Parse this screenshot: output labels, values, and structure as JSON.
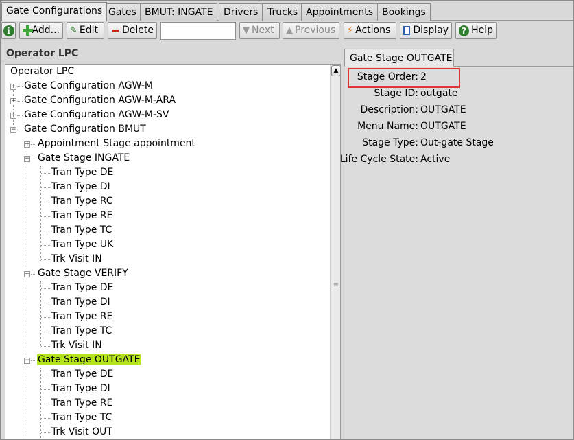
{
  "tabs": [
    {
      "label": "Gate Configurations",
      "active": true
    },
    {
      "label": "Gates"
    },
    {
      "label": "BMUT: INGATE"
    },
    {
      "label": "Drivers"
    },
    {
      "label": "Trucks"
    },
    {
      "label": "Appointments"
    },
    {
      "label": "Bookings"
    }
  ],
  "toolbar": {
    "add": "Add...",
    "edit": "Edit",
    "delete": "Delete",
    "search_value": "",
    "next": "Next",
    "previous": "Previous",
    "actions": "Actions",
    "display": "Display",
    "help": "Help"
  },
  "left_panel": {
    "title": "Operator LPC",
    "tree": [
      {
        "label": "Operator LPC"
      },
      {
        "label": "Gate Configuration AGW-M",
        "expander": "+"
      },
      {
        "label": "Gate Configuration AGW-M-ARA",
        "expander": "+"
      },
      {
        "label": "Gate Configuration AGW-M-SV",
        "expander": "+"
      },
      {
        "label": "Gate Configuration BMUT",
        "expander": "−"
      },
      {
        "label": "Appointment Stage appointment",
        "expander": "+"
      },
      {
        "label": "Gate Stage INGATE",
        "expander": "−"
      },
      {
        "label": "Tran Type DE"
      },
      {
        "label": "Tran Type DI"
      },
      {
        "label": "Tran Type RC"
      },
      {
        "label": "Tran Type RE"
      },
      {
        "label": "Tran Type TC"
      },
      {
        "label": "Tran Type UK"
      },
      {
        "label": "Trk Visit IN"
      },
      {
        "label": "Gate Stage VERIFY",
        "expander": "−"
      },
      {
        "label": "Tran Type DE"
      },
      {
        "label": "Tran Type DI"
      },
      {
        "label": "Tran Type RE"
      },
      {
        "label": "Tran Type TC"
      },
      {
        "label": "Trk Visit IN"
      },
      {
        "label": "Gate Stage OUTGATE",
        "expander": "−",
        "selected": true
      },
      {
        "label": "Tran Type DE"
      },
      {
        "label": "Tran Type DI"
      },
      {
        "label": "Tran Type RE"
      },
      {
        "label": "Tran Type TC"
      },
      {
        "label": "Trk Visit OUT"
      }
    ]
  },
  "detail": {
    "tab_label": "Gate Stage OUTGATE",
    "properties": [
      {
        "key": "Stage Order:",
        "value": "2",
        "highlighted": true
      },
      {
        "key": "Stage ID:",
        "value": "outgate"
      },
      {
        "key": "Description:",
        "value": "OUTGATE"
      },
      {
        "key": "Menu Name:",
        "value": "OUTGATE"
      },
      {
        "key": "Stage Type:",
        "value": "Out-gate Stage"
      },
      {
        "key": "Life Cycle State:",
        "value": "Active"
      }
    ]
  },
  "colors": {
    "selected_highlight": "#b5e61d",
    "annotation_box": "#e03434"
  }
}
